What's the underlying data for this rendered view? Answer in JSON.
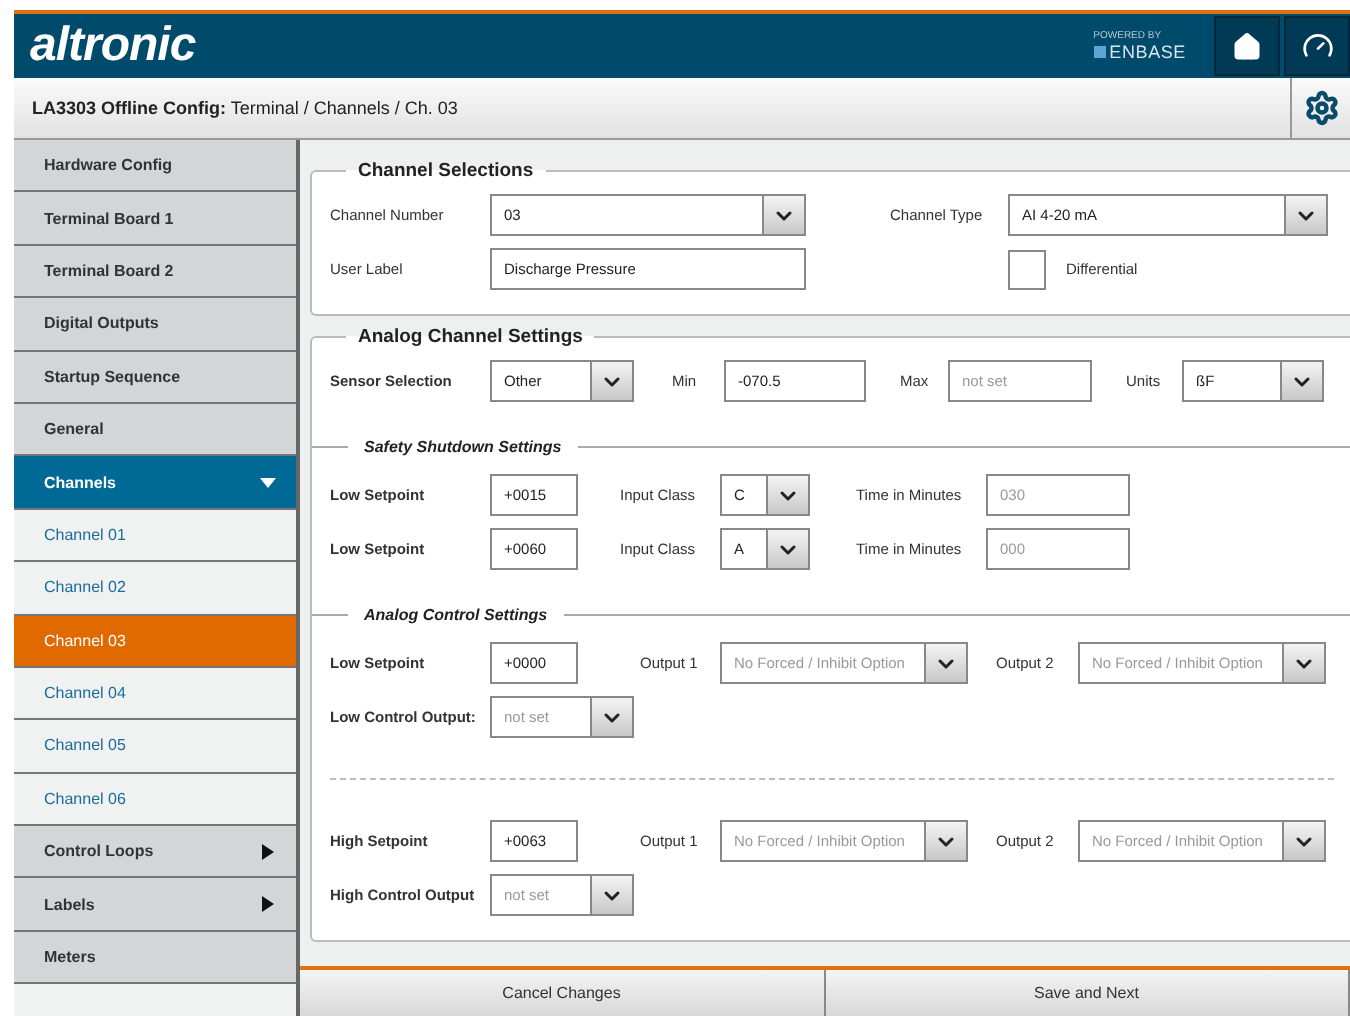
{
  "header": {
    "logo": "altronic",
    "powered_by": "POWERED BY",
    "brand": "ENBASE"
  },
  "breadcrumb": {
    "title": "LA3303 Offline Config:",
    "path": "Terminal / Channels / Ch. 03"
  },
  "sidebar": {
    "items": [
      {
        "label": "Hardware Config",
        "kind": "top",
        "selected": false
      },
      {
        "label": "Terminal Board 1",
        "kind": "top",
        "selected": false
      },
      {
        "label": "Terminal Board 2",
        "kind": "top",
        "selected": false
      },
      {
        "label": "Digital Outputs",
        "kind": "top",
        "selected": false
      },
      {
        "label": "Startup Sequence",
        "kind": "top",
        "selected": false
      },
      {
        "label": "General",
        "kind": "top",
        "selected": false
      },
      {
        "label": "Channels",
        "kind": "group",
        "expanded": true,
        "selected": false,
        "children": [
          {
            "label": "Channel 01",
            "selected": false
          },
          {
            "label": "Channel 02",
            "selected": false
          },
          {
            "label": "Channel 03",
            "selected": true
          },
          {
            "label": "Channel 04",
            "selected": false
          },
          {
            "label": "Channel 05",
            "selected": false
          },
          {
            "label": "Channel 06",
            "selected": false
          }
        ]
      },
      {
        "label": "Control Loops",
        "kind": "group",
        "expanded": false,
        "selected": false
      },
      {
        "label": "Labels",
        "kind": "group",
        "expanded": false,
        "selected": false
      },
      {
        "label": "Meters",
        "kind": "top",
        "selected": false
      }
    ]
  },
  "sections": [
    {
      "title": "Channel Selections",
      "blocks": [
        {
          "kind": "row",
          "fields": [
            {
              "kind": "label",
              "text": "Channel Number"
            },
            {
              "kind": "select",
              "value": "03"
            },
            {
              "kind": "label",
              "text": "Channel Type"
            },
            {
              "kind": "select",
              "value": "AI 4-20 mA"
            }
          ]
        },
        {
          "kind": "row",
          "fields": [
            {
              "kind": "label",
              "text": "User Label"
            },
            {
              "kind": "input",
              "value": "Discharge Pressure"
            },
            {
              "kind": "checkbox",
              "text": "Differential",
              "checked": false
            }
          ]
        }
      ]
    },
    {
      "title": "Analog Channel Settings",
      "blocks": [
        {
          "kind": "row",
          "fields": [
            {
              "kind": "row-label",
              "text": "Sensor Selection"
            },
            {
              "kind": "select",
              "value": "Other"
            },
            {
              "kind": "label",
              "text": "Min"
            },
            {
              "kind": "input",
              "value": "-070.5"
            },
            {
              "kind": "label",
              "text": "Max"
            },
            {
              "kind": "input",
              "placeholder": "not set"
            },
            {
              "kind": "label",
              "text": "Units"
            },
            {
              "kind": "select",
              "value": "ßF"
            }
          ]
        },
        {
          "kind": "subheading",
          "text": "Safety Shutdown Settings"
        },
        {
          "kind": "row",
          "fields": [
            {
              "kind": "row-label",
              "text": "Low Setpoint"
            },
            {
              "kind": "input",
              "value": "+0015"
            },
            {
              "kind": "label",
              "text": "Input Class"
            },
            {
              "kind": "select",
              "value": "C"
            },
            {
              "kind": "label",
              "text": "Time in Minutes"
            },
            {
              "kind": "input",
              "placeholder": "030"
            }
          ]
        },
        {
          "kind": "row",
          "fields": [
            {
              "kind": "row-label",
              "text": "Low Setpoint"
            },
            {
              "kind": "input",
              "value": "+0060"
            },
            {
              "kind": "label",
              "text": "Input Class"
            },
            {
              "kind": "select",
              "value": "A"
            },
            {
              "kind": "label",
              "text": "Time in Minutes"
            },
            {
              "kind": "input",
              "placeholder": "000"
            }
          ]
        },
        {
          "kind": "subheading",
          "text": "Analog Control Settings"
        },
        {
          "kind": "row",
          "fields": [
            {
              "kind": "row-label",
              "text": "Low Setpoint"
            },
            {
              "kind": "input",
              "value": "+0000"
            },
            {
              "kind": "label",
              "text": "Output 1"
            },
            {
              "kind": "select",
              "placeholder": "No Forced / Inhibit Option"
            },
            {
              "kind": "label",
              "text": "Output 2"
            },
            {
              "kind": "select",
              "placeholder": "No Forced / Inhibit Option"
            }
          ]
        },
        {
          "kind": "row",
          "fields": [
            {
              "kind": "row-label",
              "text": "Low Control Output:"
            },
            {
              "kind": "select",
              "placeholder": "not set"
            }
          ]
        },
        {
          "kind": "separator"
        },
        {
          "kind": "row",
          "fields": [
            {
              "kind": "row-label",
              "text": "High Setpoint"
            },
            {
              "kind": "input",
              "value": "+0063"
            },
            {
              "kind": "label",
              "text": "Output 1"
            },
            {
              "kind": "select",
              "placeholder": "No Forced / Inhibit Option"
            },
            {
              "kind": "label",
              "text": "Output 2"
            },
            {
              "kind": "select",
              "placeholder": "No Forced / Inhibit Option"
            }
          ]
        },
        {
          "kind": "row",
          "fields": [
            {
              "kind": "row-label",
              "text": "High Control Output"
            },
            {
              "kind": "select",
              "placeholder": "not set"
            }
          ]
        }
      ]
    }
  ],
  "footer": {
    "buttons": [
      "Cancel Changes",
      "Save and Next"
    ]
  }
}
